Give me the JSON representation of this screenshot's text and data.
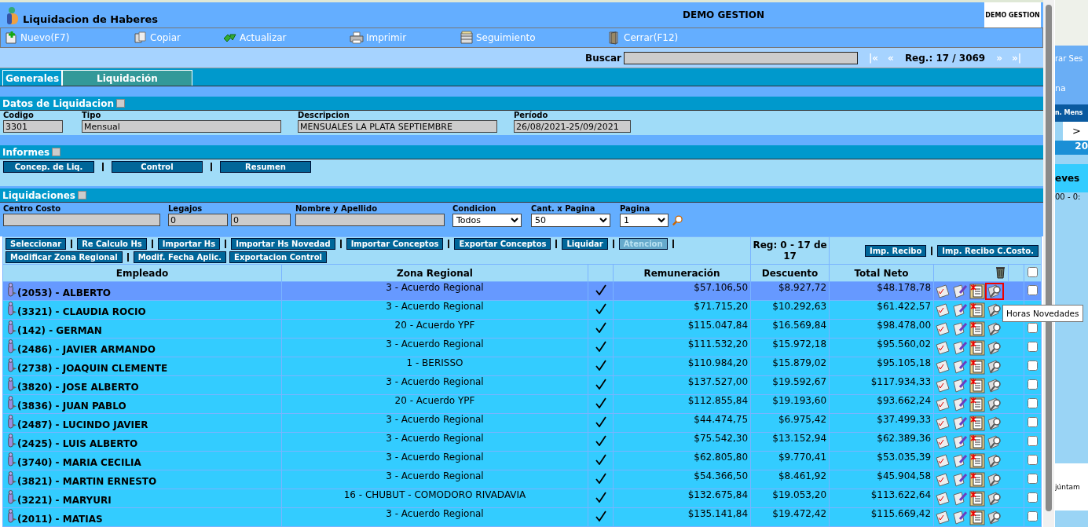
{
  "window": {
    "title": "Liquidacion de Haberes",
    "company": "DEMO GESTION",
    "logo_text": "DEMO GESTION"
  },
  "toolbar": [
    {
      "label": "Nuevo(F7)"
    },
    {
      "label": "Copiar"
    },
    {
      "label": "Actualizar"
    },
    {
      "label": "Imprimir"
    },
    {
      "label": "Seguimiento"
    },
    {
      "label": "Cerrar(F12)"
    }
  ],
  "search": {
    "label": "Buscar"
  },
  "nav": {
    "first": "|«",
    "prev": "«",
    "record": "Reg.: 17 / 3069",
    "next": "»",
    "last": "»|"
  },
  "tabs": [
    {
      "label": "Generales",
      "selected": false
    },
    {
      "label": "Liquidación",
      "selected": true
    }
  ],
  "datos": {
    "title": "Datos de Liquidacion",
    "fields": [
      {
        "label": "Codigo",
        "value": "3301"
      },
      {
        "label": "Tipo",
        "value": "Mensual"
      },
      {
        "label": "Descripcion",
        "value": "MENSUALES LA PLATA SEPTIEMBRE"
      },
      {
        "label": "Período",
        "value": "26/08/2021-25/09/2021"
      }
    ]
  },
  "informes": {
    "title": "Informes",
    "buttons": [
      "Concep. de Liq.",
      "Control",
      "Resumen"
    ]
  },
  "liquidaciones": {
    "title": "Liquidaciones",
    "filters": [
      {
        "label": "Centro Costo",
        "kind": "text"
      },
      {
        "label": "Legajos",
        "kind": "pair",
        "values": [
          "0",
          "0"
        ]
      },
      {
        "label": "Nombre y Apellido",
        "kind": "text"
      },
      {
        "label": "Condicion",
        "kind": "select",
        "value": "Todos"
      },
      {
        "label": "Cant. x Pagina",
        "kind": "select",
        "value": "50"
      },
      {
        "label": "Pagina",
        "kind": "select",
        "value": "1"
      }
    ],
    "actions": [
      {
        "label": "Seleccionar",
        "disabled": false,
        "separator_after": true
      },
      {
        "label": "Re Calculo Hs",
        "disabled": false,
        "separator_after": true
      },
      {
        "label": "Importar Hs",
        "disabled": false,
        "separator_after": true
      },
      {
        "label": "Importar Hs Novedad",
        "disabled": false,
        "separator_after": true
      },
      {
        "label": "Importar Conceptos",
        "disabled": false,
        "separator_after": true
      },
      {
        "label": "Exportar Conceptos",
        "disabled": false,
        "separator_after": true
      },
      {
        "label": "Liquidar",
        "disabled": false,
        "separator_after": true
      },
      {
        "label": "Atencion",
        "disabled": true,
        "separator_after": true
      },
      {
        "label": "Modificar Zona Regional",
        "disabled": false,
        "separator_after": true
      },
      {
        "label": "Modif. Fecha Aplic.",
        "disabled": false,
        "separator_after": false
      },
      {
        "label": "Exportacion Control",
        "disabled": false,
        "separator_after": false
      }
    ],
    "records": "Reg: 0 - 17 de 17",
    "print_buttons": [
      "Imp. Recibo",
      "Imp. Recibo C.Costo."
    ]
  },
  "table": {
    "columns": {
      "employee": "Empleado",
      "zone": "Zona Regional",
      "pay": "Remuneración",
      "discount": "Descuento",
      "net": "Total Neto"
    },
    "select_all_checked": false,
    "rows": [
      {
        "employee": "(2053) - ALBERTO",
        "zone": "3 - Acuerdo Regional",
        "liquidated": true,
        "pay": "$57.106,50",
        "discount": "$8.927,72",
        "net": "$48.178,78",
        "selected": true,
        "hours_focused": true,
        "checked": false
      },
      {
        "employee": "(3321) - CLAUDIA ROCIO",
        "zone": "3 - Acuerdo Regional",
        "liquidated": true,
        "pay": "$71.715,20",
        "discount": "$10.292,63",
        "net": "$61.422,57",
        "selected": false,
        "hours_focused": false
      },
      {
        "employee": "(142) - GERMAN",
        "zone": "20 - Acuerdo YPF",
        "liquidated": true,
        "pay": "$115.047,84",
        "discount": "$16.569,84",
        "net": "$98.478,00",
        "selected": false,
        "hours_focused": false,
        "checked": false
      },
      {
        "employee": "(2486) - JAVIER ARMANDO",
        "zone": "3 - Acuerdo Regional",
        "liquidated": true,
        "pay": "$111.532,20",
        "discount": "$15.972,18",
        "net": "$95.560,02",
        "selected": false,
        "hours_focused": false,
        "checked": false
      },
      {
        "employee": "(2738) - JOAQUIN CLEMENTE",
        "zone": "1 - BERISSO",
        "liquidated": true,
        "pay": "$110.984,20",
        "discount": "$15.879,02",
        "net": "$95.105,18",
        "selected": false,
        "hours_focused": false,
        "checked": false
      },
      {
        "employee": "(3820) - JOSE ALBERTO",
        "zone": "3 - Acuerdo Regional",
        "liquidated": true,
        "pay": "$137.527,00",
        "discount": "$19.592,67",
        "net": "$117.934,33",
        "selected": false,
        "hours_focused": false,
        "checked": false
      },
      {
        "employee": "(3836) - JUAN PABLO",
        "zone": "20 - Acuerdo YPF",
        "liquidated": true,
        "pay": "$112.855,84",
        "discount": "$19.193,60",
        "net": "$93.662,24",
        "selected": false,
        "hours_focused": false,
        "checked": false
      },
      {
        "employee": "(2487) - LUCINDO JAVIER",
        "zone": "3 - Acuerdo Regional",
        "liquidated": true,
        "pay": "$44.474,75",
        "discount": "$6.975,42",
        "net": "$37.499,33",
        "selected": false,
        "hours_focused": false,
        "checked": false
      },
      {
        "employee": "(2425) - LUIS ALBERTO",
        "zone": "3 - Acuerdo Regional",
        "liquidated": true,
        "pay": "$75.542,30",
        "discount": "$13.152,94",
        "net": "$62.389,36",
        "selected": false,
        "hours_focused": false,
        "checked": false
      },
      {
        "employee": "(3740) - MARIA CECILIA",
        "zone": "3 - Acuerdo Regional",
        "liquidated": true,
        "pay": "$62.805,80",
        "discount": "$9.770,41",
        "net": "$53.035,39",
        "selected": false,
        "hours_focused": false,
        "checked": false
      },
      {
        "employee": "(3821) - MARTIN ERNESTO",
        "zone": "3 - Acuerdo Regional",
        "liquidated": true,
        "pay": "$54.366,50",
        "discount": "$8.461,92",
        "net": "$45.904,58",
        "selected": false,
        "hours_focused": false,
        "checked": false
      },
      {
        "employee": "(3221) - MARYURI",
        "zone": "16 - CHUBUT - COMODORO RIVADAVIA",
        "liquidated": true,
        "pay": "$132.675,84",
        "discount": "$19.053,20",
        "net": "$113.622,64",
        "selected": false,
        "hours_focused": false,
        "checked": false
      },
      {
        "employee": "(2011) - MATIAS",
        "zone": "3 - Acuerdo Regional",
        "liquidated": true,
        "pay": "$135.141,84",
        "discount": "$19.472,42",
        "net": "$115.669,42",
        "selected": false,
        "hours_focused": false,
        "checked": false
      }
    ]
  },
  "tooltip": "Horas Novedades",
  "background_page": {
    "fragments": [
      {
        "kind": "link",
        "text": "rar Ses"
      },
      {
        "kind": "menu",
        "text": "na"
      },
      {
        "kind": "tab",
        "text": "n. Mens"
      },
      {
        "kind": "arrow",
        "text": ">"
      },
      {
        "kind": "year",
        "text": "20"
      },
      {
        "kind": "day",
        "text": "eves"
      },
      {
        "kind": "time",
        "text": "00 - 0:"
      },
      {
        "kind": "chat",
        "text": "júntam"
      }
    ]
  }
}
